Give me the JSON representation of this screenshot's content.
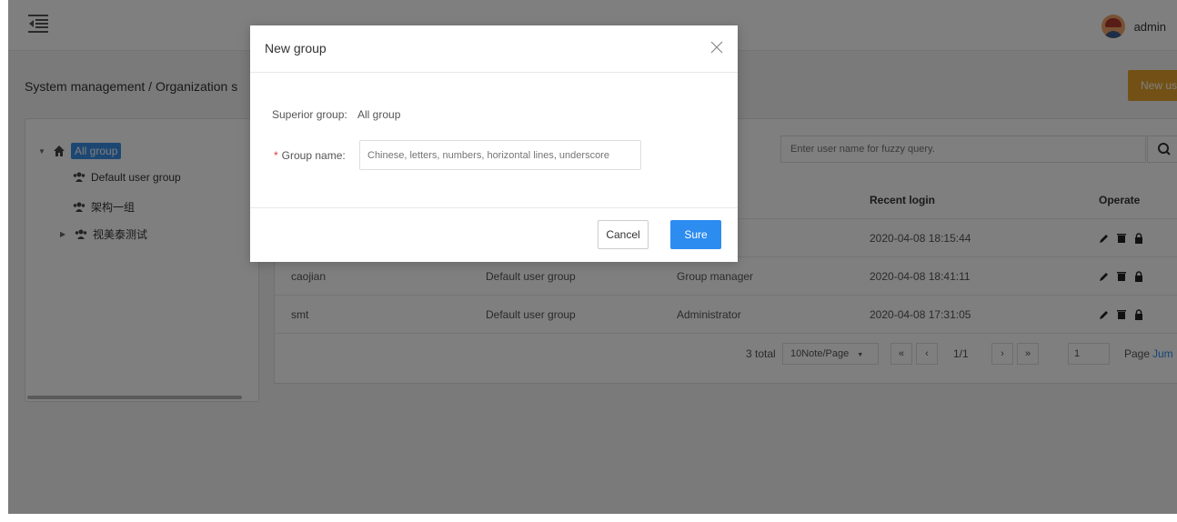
{
  "topbar": {
    "username": "admin"
  },
  "breadcrumb": "System management  /  Organization s",
  "new_user_button": "New us",
  "tree": {
    "items": [
      {
        "label": "All group"
      },
      {
        "label": "Default user group"
      },
      {
        "label": "架构一组"
      },
      {
        "label": "视美泰测试"
      }
    ]
  },
  "search": {
    "placeholder": "Enter user name for fuzzy query."
  },
  "table": {
    "headers": {
      "recent_login": "Recent login",
      "operate": "Operate"
    },
    "rows": [
      {
        "user": "",
        "group": "",
        "role": "",
        "login": "2020-04-08 18:15:44"
      },
      {
        "user": "caojian",
        "group": "Default user group",
        "role": "Group manager",
        "login": "2020-04-08 18:41:11"
      },
      {
        "user": "smt",
        "group": "Default user group",
        "role": "Administrator",
        "login": "2020-04-08 17:31:05"
      }
    ]
  },
  "pagination": {
    "total": "3 total",
    "page_size": "10Note/Page",
    "first": "«",
    "prev": "‹",
    "page_info": "1/1",
    "next": "›",
    "last": "»",
    "page_input": "1",
    "page_label": "Page",
    "jump": "Jum"
  },
  "modal": {
    "title": "New group",
    "superior_label": "Superior group:",
    "superior_value": "All group",
    "required_mark": "*",
    "group_name_label": "Group name:",
    "group_name_placeholder": "Chinese, letters, numbers, horizontal lines, underscore",
    "cancel": "Cancel",
    "sure": "Sure"
  },
  "colors": {
    "primary": "#2d8cf0",
    "warning": "#e6a22c",
    "selected": "#3a8ee6",
    "required": "#e53935"
  }
}
